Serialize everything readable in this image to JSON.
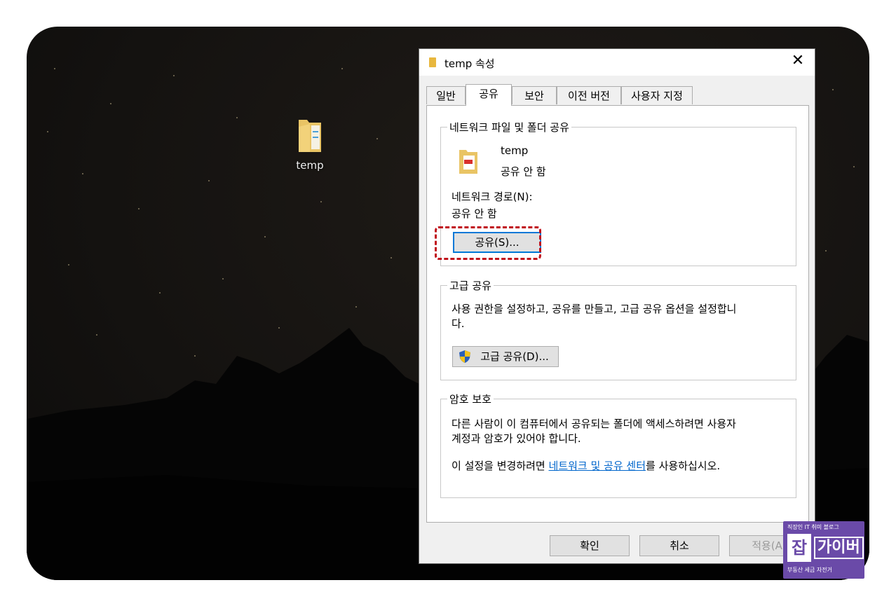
{
  "desktop": {
    "icon_label": "temp"
  },
  "dialog": {
    "title": "temp 속성",
    "close_label": "✕",
    "tabs": [
      {
        "label": "일반"
      },
      {
        "label": "공유"
      },
      {
        "label": "보안"
      },
      {
        "label": "이전 버전"
      },
      {
        "label": "사용자 지정"
      }
    ],
    "active_tab": "공유",
    "network_sharing": {
      "group_title": "네트워크 파일 및 폴더 공유",
      "item_name": "temp",
      "item_status": "공유 안 함",
      "path_label": "네트워크 경로(N):",
      "path_value": "공유 안 함",
      "share_button": "공유(S)..."
    },
    "advanced_sharing": {
      "group_title": "고급 공유",
      "description_line1": "사용 권한을 설정하고, 공유를 만들고, 고급 공유 옵션을 설정합니",
      "description_line2": "다.",
      "button": "고급 공유(D)..."
    },
    "password_protection": {
      "group_title": "암호 보호",
      "description_line1": "다른 사람이 이 컴퓨터에서 공유되는 폴더에 액세스하려면 사용자",
      "description_line2": "계정과 암호가 있어야 합니다.",
      "change_prefix": "이 설정을 변경하려면 ",
      "change_link": "네트워크 및 공유 센터",
      "change_suffix": "를 사용하십시오."
    },
    "footer": {
      "ok": "확인",
      "cancel": "취소",
      "apply": "적용(A)"
    }
  },
  "watermark": {
    "top_text": "직장인 IT 취미 블로그",
    "logo_char": "잡",
    "logo_text": "가이버",
    "bottom_text": "부동산 세금 자전거"
  },
  "colors": {
    "highlight_dash": "#c0101a",
    "focus_border": "#0078d7",
    "link": "#0066cc"
  }
}
